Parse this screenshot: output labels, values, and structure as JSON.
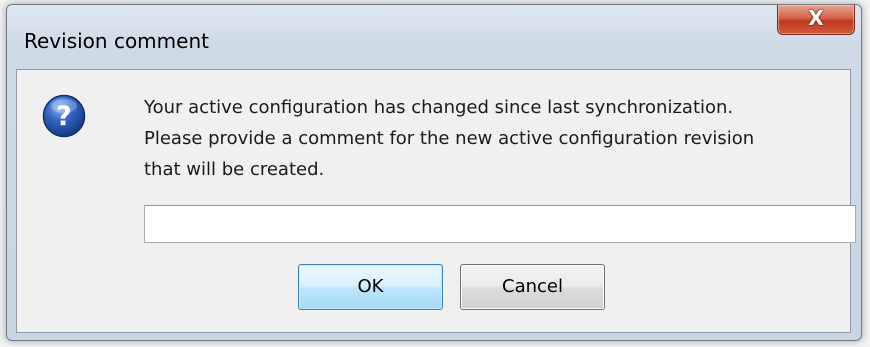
{
  "dialog": {
    "title": "Revision comment",
    "close_glyph": "X"
  },
  "message": {
    "lines": [
      "Your active configuration has changed since last synchronization.",
      "Please provide a comment for the new active configuration revision",
      "that will be created."
    ]
  },
  "comment_field": {
    "value": ""
  },
  "buttons": {
    "ok_label": "OK",
    "cancel_label": "Cancel"
  },
  "icons": {
    "dialog_icon": "question-icon",
    "close": "close-icon"
  },
  "colors": {
    "close_button": "#c2391f",
    "question_icon": "#1f4fa8",
    "ok_button_border": "#3c7fb1"
  }
}
